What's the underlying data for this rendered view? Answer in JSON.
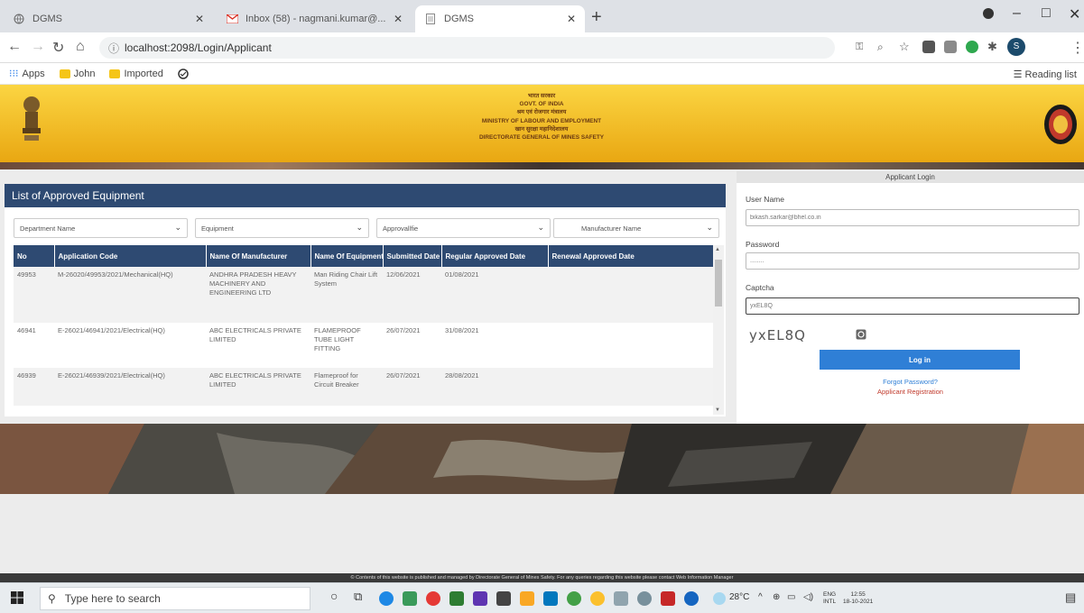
{
  "browser": {
    "tabs": [
      {
        "title": "DGMS",
        "active": false
      },
      {
        "title": "Inbox (58) - nagmani.kumar@...",
        "active": false
      },
      {
        "title": "DGMS",
        "active": true
      }
    ],
    "url": "localhost:2098/Login/Applicant",
    "bookmarks": [
      "Apps",
      "John",
      "Imported"
    ],
    "reading_list": "Reading list",
    "profile_initial": "S"
  },
  "header": {
    "lines": [
      "भारत सरकार",
      "GOVT. OF INDIA",
      "श्रम एवं रोजगार मंत्रालय",
      "MINISTRY OF LABOUR AND EMPLOYMENT",
      "खान सुरक्षा महानिदेशालय",
      "DIRECTORATE GENERAL OF MINES SAFETY"
    ]
  },
  "equipment": {
    "title": "List of Approved Equipment",
    "filters": [
      "Department Name",
      "Equipment",
      "Approvallfie",
      "Manufacturer Name"
    ],
    "columns": [
      "No",
      "Application Code",
      "Name Of Manufacturer",
      "Name Of Equipment",
      "Submitted Date",
      "Regular Approved Date",
      "Renewal Approved Date"
    ],
    "rows": [
      [
        "49953",
        "M-26020/49953/2021/Mechanical(HQ)",
        "ANDHRA PRADESH HEAVY MACHINERY AND ENGINEERING LTD",
        "Man Riding Chair Lift System",
        "12/06/2021",
        "01/08/2021",
        ""
      ],
      [
        "46941",
        "E-26021/46941/2021/Electrical(HQ)",
        "ABC ELECTRICALS PRIVATE LIMITED",
        "FLAMEPROOF TUBE LIGHT FITTING",
        "26/07/2021",
        "31/08/2021",
        ""
      ],
      [
        "46939",
        "E-26021/46939/2021/Electrical(HQ)",
        "ABC ELECTRICALS PRIVATE LIMITED",
        "Flameproof for Circuit Breaker",
        "26/07/2021",
        "28/08/2021",
        ""
      ]
    ]
  },
  "login": {
    "heading": "Applicant Login",
    "username_label": "User Name",
    "username_value": "bikash.sarkar@bhel.co.in",
    "password_label": "Password",
    "password_value": "........",
    "captcha_label": "Captcha",
    "captcha_input": "yxEL8Q",
    "captcha_text": "yxEL8Q",
    "login_button": "Log in",
    "forgot_link": "Forgot Password?",
    "register_link": "Applicant Registration"
  },
  "footer": {
    "text": "© Contents of this website is published and managed by Directorate General of Mines Safety. For any queries regarding this website please contact Web Information Manager"
  },
  "taskbar": {
    "search_placeholder": "Type here to search",
    "weather": "28°C",
    "lang": "ENG",
    "lang_sub": "INTL",
    "time": "12:55",
    "date": "18-10-2021"
  },
  "colors": {
    "navy": "#2e4a72",
    "button_blue": "#2f7fd6",
    "banner_gold": "#f0b820",
    "link_red": "#c0392b"
  }
}
